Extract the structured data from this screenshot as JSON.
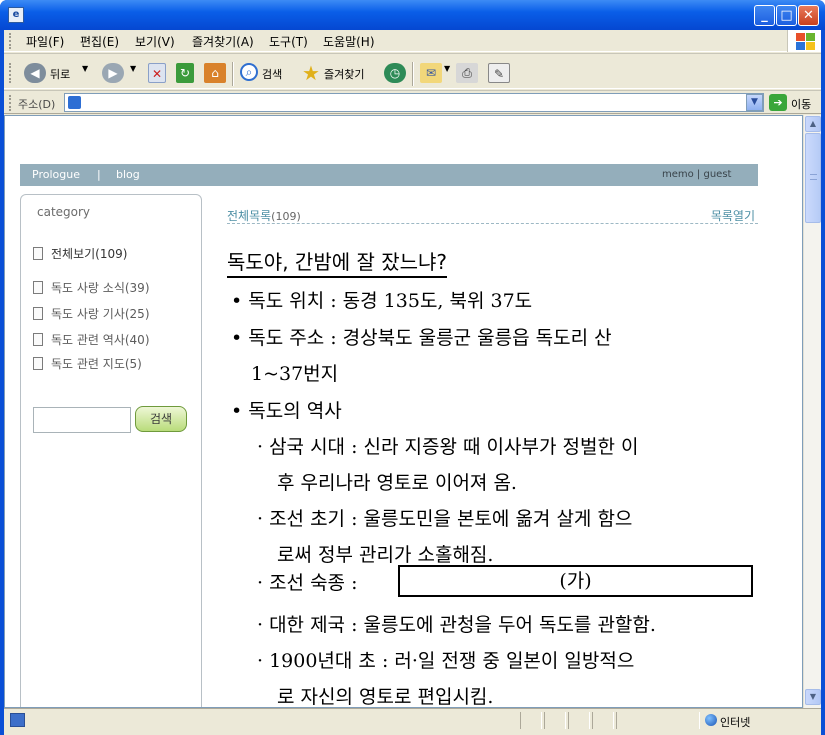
{
  "menu": [
    "파일(F)",
    "편집(E)",
    "보기(V)",
    "즐겨찾기(A)",
    "도구(T)",
    "도움말(H)"
  ],
  "toolbar": {
    "back_label": "뒤로",
    "search_label": "검색",
    "favorites_label": "즐겨찾기"
  },
  "address": {
    "label": "주소(D)",
    "go_label": "이동"
  },
  "status": {
    "zone": "인터넷"
  },
  "blog": {
    "nav": [
      "Prologue",
      "blog"
    ],
    "nav_sep": "|",
    "nav_right": "memo  |  guest",
    "category_title": "category",
    "categories": [
      "전체보기(109)",
      "독도 사랑 소식(39)",
      "독도 사랑 기사(25)",
      "독도 관련 역사(40)",
      "독도 관련 지도(5)"
    ],
    "search_button": "검색",
    "list_label": "전체목록",
    "list_count": "(109)",
    "list_open": "목록열기"
  },
  "post": {
    "title": "독도야, 간밤에 잘 잤느냐?",
    "lines": [
      "• 독도 위치 : 동경 135도, 북위 37도",
      "• 독도  주소  :  경상북도  울릉군  울릉읍  독도리  산",
      "1~37번지",
      "• 독도의 역사",
      "· 삼국 시대 : 신라 지증왕 때 이사부가 정벌한 이",
      "후 우리나라 영토로 이어져 옴.",
      "· 조선 초기 : 울릉도민을 본토에 옮겨 살게 함으",
      "로써 정부 관리가 소홀해짐.",
      "· 조선 숙종 :",
      "· 대한 제국 : 울릉도에 관청을 두어 독도를 관할함.",
      "· 1900년대 초 : 러·일 전쟁 중 일본이 일방적으",
      "로 자신의 영토로 편입시킴."
    ],
    "blank": "(가)"
  }
}
